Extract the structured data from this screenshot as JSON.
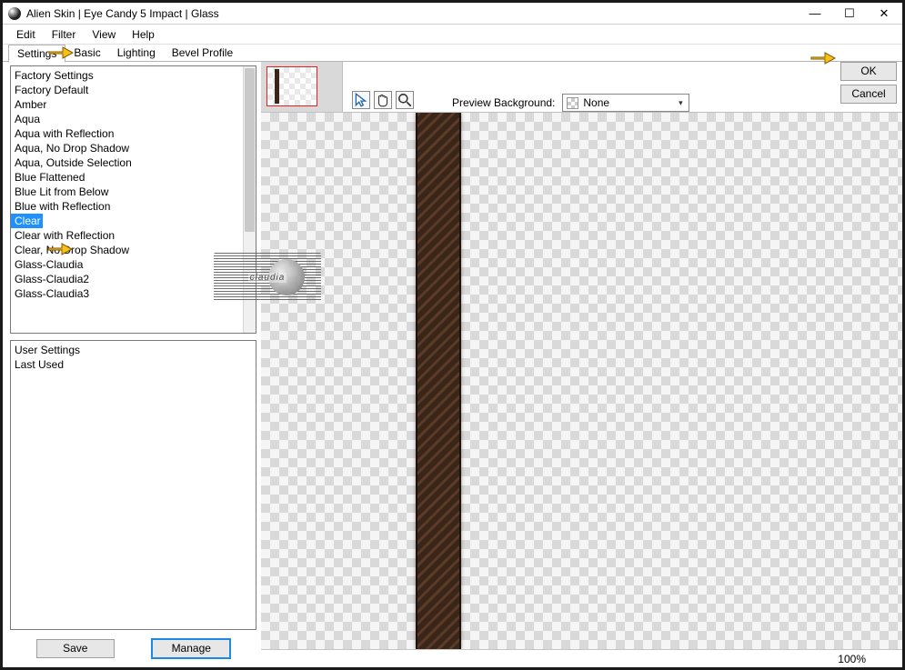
{
  "window": {
    "title": "Alien Skin | Eye Candy 5 Impact | Glass",
    "controls": {
      "min": "—",
      "max": "☐",
      "close": "✕"
    }
  },
  "menu": [
    "Edit",
    "Filter",
    "View",
    "Help"
  ],
  "tabs": [
    "Settings",
    "Basic",
    "Lighting",
    "Bevel Profile"
  ],
  "active_tab": "Settings",
  "factory_list": {
    "header": "Factory Settings",
    "items": [
      "Factory Default",
      "Amber",
      "Aqua",
      "Aqua with Reflection",
      "Aqua, No Drop Shadow",
      "Aqua, Outside Selection",
      "Blue Flattened",
      "Blue Lit from Below",
      "Blue with Reflection",
      "Clear",
      "Clear with Reflection",
      "Clear, No Drop Shadow",
      "Glass-Claudia",
      "Glass-Claudia2",
      "Glass-Claudia3"
    ],
    "selected_index": 9
  },
  "user_list": {
    "header": "User Settings",
    "items": [
      "Last Used"
    ]
  },
  "buttons": {
    "save": "Save",
    "manage": "Manage",
    "ok": "OK",
    "cancel": "Cancel"
  },
  "preview": {
    "label": "Preview Background:",
    "value": "None"
  },
  "tools": {
    "pointer": "pointer-tool-icon",
    "hand": "hand-tool-icon",
    "zoom": "zoom-tool-icon"
  },
  "status": {
    "zoom": "100%"
  },
  "watermark": {
    "text": "claudia"
  }
}
